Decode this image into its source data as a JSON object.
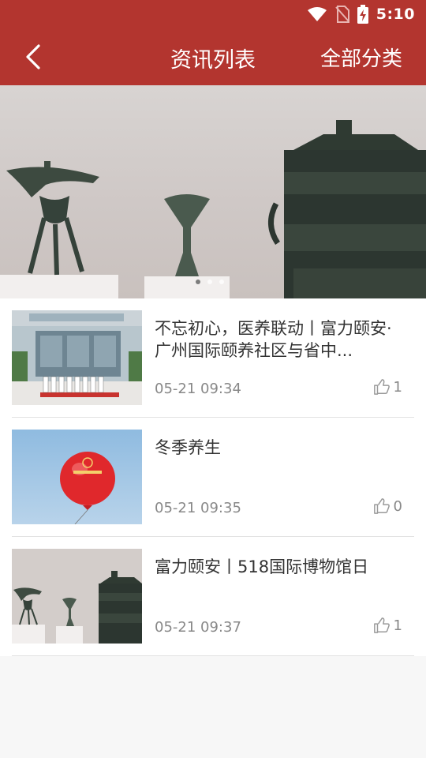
{
  "status_bar": {
    "time": "5:10",
    "icons": [
      "wifi-icon",
      "no-sim-icon",
      "battery-charging-icon"
    ]
  },
  "header": {
    "back_icon": "chevron-left-icon",
    "title": "资讯列表",
    "action_label": "全部分类"
  },
  "banner": {
    "image": "bronze-artifacts-photo",
    "page_count": 3,
    "active_page": 1
  },
  "news": [
    {
      "title": "不忘初心，医养联动丨富力颐安·广州国际颐养社区与省中...",
      "time": "05-21 09:34",
      "likes": "1",
      "thumbnail": "building-group-photo"
    },
    {
      "title": "冬季养生",
      "time": "05-21 09:35",
      "likes": "0",
      "thumbnail": "red-balloon-photo"
    },
    {
      "title": "富力颐安丨518国际博物馆日",
      "time": "05-21 09:37",
      "likes": "1",
      "thumbnail": "bronze-artifacts-photo"
    }
  ],
  "colors": {
    "primary": "#b3352f",
    "text": "#333333",
    "muted": "#888888",
    "divider": "#e2e2e2"
  }
}
